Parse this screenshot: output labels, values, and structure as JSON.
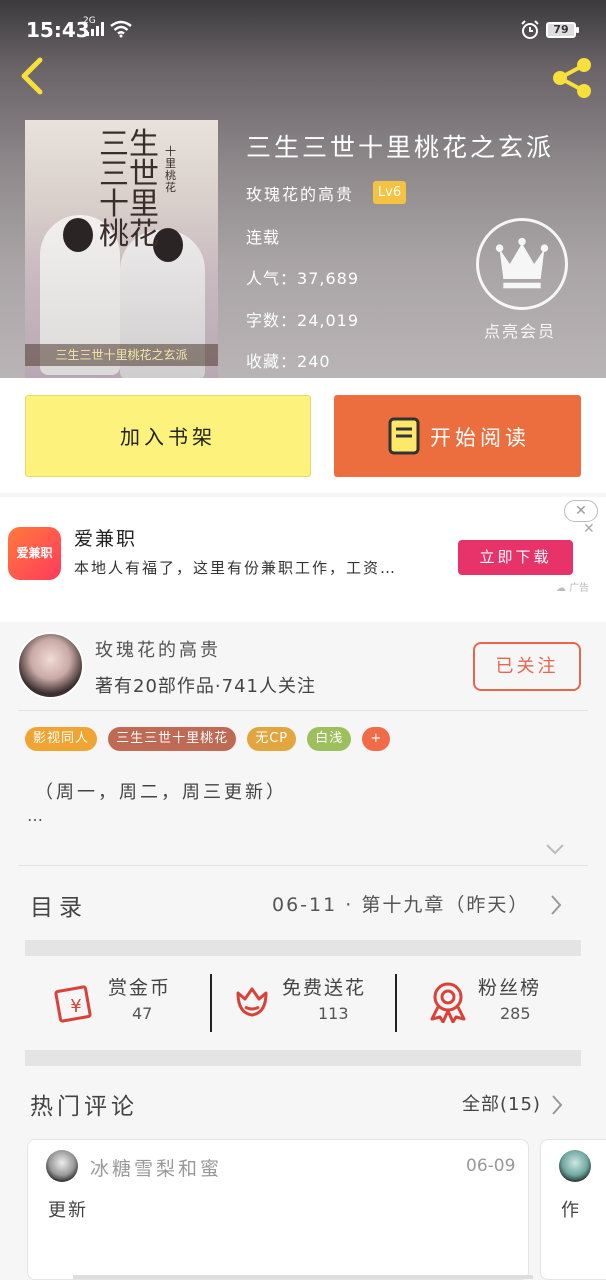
{
  "status_bar": {
    "time": "15:43",
    "network": "2G",
    "battery": "79"
  },
  "book": {
    "title": "三生三世十里桃花之玄派",
    "author": "玫瑰花的高贵",
    "level": "Lv6",
    "state": "连载",
    "popularity_label": "人气：",
    "popularity": "37,689",
    "words_label": "字数：",
    "words": "24,019",
    "favorites_label": "收藏：",
    "favorites": "240",
    "cover_title": "三生三世十里桃花",
    "cover_subtitle": "十里桃花",
    "cover_strip": "三生三世十里桃花之玄派",
    "vip_label": "点亮会员"
  },
  "actions": {
    "add_shelf": "加入书架",
    "start_read": "开始阅读"
  },
  "ad": {
    "logo_text": "爱兼职",
    "title": "爱兼职",
    "description": "本地人有福了，这里有份兼职工作，工资…",
    "button": "立即下载",
    "tag": "广告"
  },
  "author_info": {
    "name": "玫瑰花的高贵",
    "stats": "著有20部作品·741人关注",
    "follow": "已关注"
  },
  "tags": [
    {
      "label": "影视同人",
      "color": "#f0a532"
    },
    {
      "label": "三生三世十里桃花",
      "color": "#bf6a55"
    },
    {
      "label": "无CP",
      "color": "#e2a640"
    },
    {
      "label": "白浅",
      "color": "#9dc05e"
    },
    {
      "label": "+",
      "color": "#f06b47"
    }
  ],
  "update_schedule": "（周一，周二，周三更新）",
  "ellipsis": "…",
  "toc": {
    "label": "目录",
    "latest": "06-11 · 第十九章（昨天）"
  },
  "stats": [
    {
      "name": "赏金币",
      "value": "47",
      "icon": "reward-coin-icon"
    },
    {
      "name": "免费送花",
      "value": "113",
      "icon": "flower-icon"
    },
    {
      "name": "粉丝榜",
      "value": "285",
      "icon": "medal-icon"
    }
  ],
  "comments_section": {
    "label": "热门评论",
    "all": "全部(15)"
  },
  "comments": [
    {
      "user": "冰糖雪梨和蜜",
      "date": "06-09",
      "text": "更新"
    },
    {
      "user": "",
      "date": "",
      "text": "作"
    }
  ],
  "colors": {
    "accent_orange": "#ec6e3f",
    "shelf_yellow": "#fdf37c",
    "follow_red": "#e8664d",
    "ad_pink": "#e8336a",
    "level_gold": "#f5c341"
  }
}
